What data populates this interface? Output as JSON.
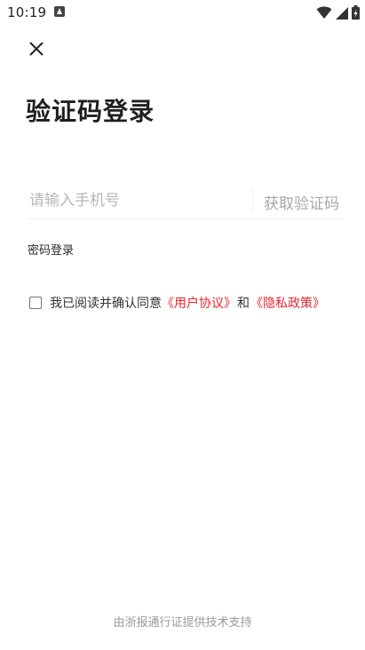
{
  "status_bar": {
    "time": "10:19",
    "icons": [
      "app-notification-icon",
      "wifi-icon",
      "signal-icon",
      "battery-icon"
    ]
  },
  "header": {
    "close_icon": "close-icon"
  },
  "title": "验证码登录",
  "phone": {
    "placeholder": "请输入手机号",
    "get_code_label": "获取验证码"
  },
  "password_login_label": "密码登录",
  "agreement": {
    "checked": false,
    "prefix": "我已阅读并确认同意",
    "user_agreement": "《用户协议》",
    "and": "和",
    "privacy_policy": "《隐私政策》",
    "link_color": "#e8252f"
  },
  "footer": "由浙报通行证提供技术支持"
}
